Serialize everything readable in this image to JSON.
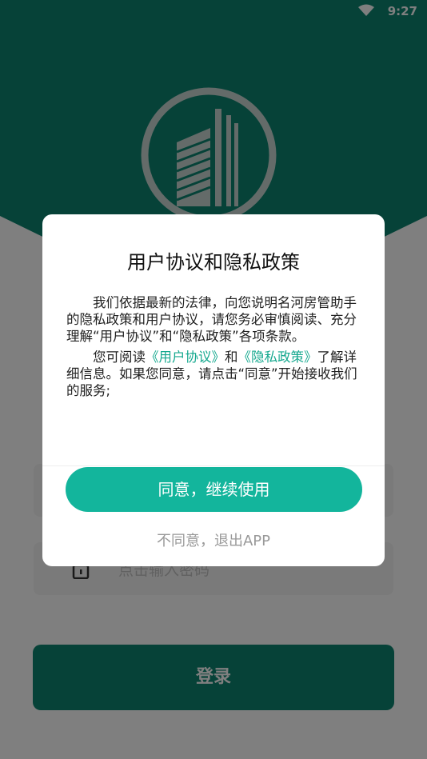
{
  "status_bar": {
    "time": "9:27",
    "wifi_icon": "wifi-icon"
  },
  "login": {
    "logo_icon": "building-logo",
    "password_placeholder": "点击输入密码",
    "password_icon": "lock-icon",
    "login_button": "登录"
  },
  "dialog": {
    "title": "用户协议和隐私政策",
    "paragraph1": "我们依据最新的法律，向您说明名河房管助手的隐私政策和用户协议，请您务必审慎阅读、充分理解“用户协议”和“隐私政策”各项条款。",
    "paragraph2_prefix": "您可阅读",
    "user_agreement_link": "《用户协议》",
    "paragraph2_and": "和",
    "privacy_policy_link": "《隐私政策》",
    "paragraph2_suffix": "了解详细信息。如果您同意，请点击“同意”开始接收我们的服务;",
    "agree_button": "同意，继续使用",
    "disagree_link": "不同意，退出APP"
  },
  "colors": {
    "brand": "#0d8571",
    "accent": "#13b59c",
    "link": "#14a88e"
  }
}
